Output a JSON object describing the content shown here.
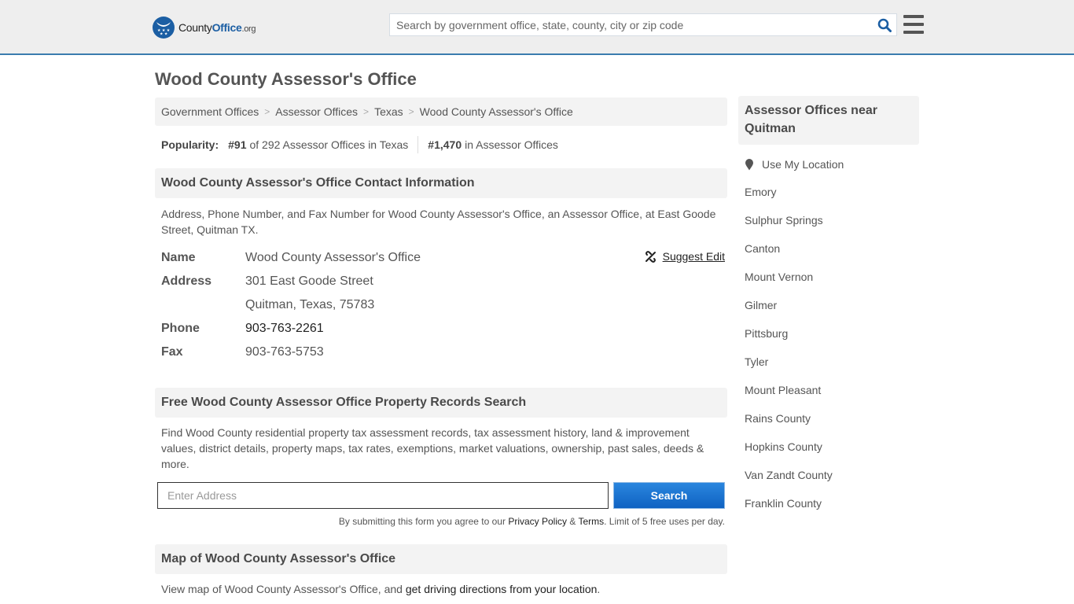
{
  "header": {
    "logo": {
      "brand_main": "County",
      "brand_accent": "Office",
      "brand_tld": ".org"
    },
    "search": {
      "placeholder": "Search by government office, state, county, city or zip code",
      "value": ""
    },
    "icons": {
      "search": "search-icon",
      "menu": "hamburger-menu-icon"
    }
  },
  "page": {
    "title": "Wood County Assessor's Office"
  },
  "breadcrumb": [
    {
      "label": "Government Offices"
    },
    {
      "label": "Assessor Offices"
    },
    {
      "label": "Texas"
    },
    {
      "label": "Wood County Assessor's Office"
    }
  ],
  "breadcrumb_separator": ">",
  "popularity": {
    "label": "Popularity:",
    "state_rank": "#91",
    "state_rank_text": "of 292 Assessor Offices in Texas",
    "national_rank": "#1,470",
    "national_rank_text": "in Assessor Offices"
  },
  "contact": {
    "heading": "Wood County Assessor's Office Contact Information",
    "description": "Address, Phone Number, and Fax Number for Wood County Assessor's Office, an Assessor Office, at East Goode Street, Quitman TX.",
    "suggest_edit": "Suggest Edit",
    "name_label": "Name",
    "name_value": "Wood County Assessor's Office",
    "address_label": "Address",
    "address_line1": "301 East Goode Street",
    "address_line2": "Quitman, Texas, 75783",
    "phone_label": "Phone",
    "phone_value": "903-763-2261",
    "fax_label": "Fax",
    "fax_value": "903-763-5753"
  },
  "property_search": {
    "heading": "Free Wood County Assessor Office Property Records Search",
    "description": "Find Wood County residential property tax assessment records, tax assessment history, land & improvement values, district details, property maps, tax rates, exemptions, market valuations, ownership, past sales, deeds & more.",
    "input_placeholder": "Enter Address",
    "input_value": "",
    "button_label": "Search",
    "disclaimer_prefix": "By submitting this form you agree to our ",
    "privacy_link": "Privacy Policy",
    "amp": " & ",
    "terms_link": "Terms",
    "disclaimer_suffix": ". Limit of 5 free uses per day."
  },
  "map": {
    "heading": "Map of Wood County Assessor's Office",
    "description_prefix": "View map of Wood County Assessor's Office, and ",
    "directions_link": "get driving directions from your location",
    "description_suffix": "."
  },
  "sidebar": {
    "heading": "Assessor Offices near Quitman",
    "use_location": "Use My Location",
    "nearby": [
      {
        "label": "Emory"
      },
      {
        "label": "Sulphur Springs"
      },
      {
        "label": "Canton"
      },
      {
        "label": "Mount Vernon"
      },
      {
        "label": "Gilmer"
      },
      {
        "label": "Pittsburg"
      },
      {
        "label": "Tyler"
      },
      {
        "label": "Mount Pleasant"
      },
      {
        "label": "Rains County"
      },
      {
        "label": "Hopkins County"
      },
      {
        "label": "Van Zandt County"
      },
      {
        "label": "Franklin County"
      }
    ]
  },
  "colors": {
    "brand_blue": "#1b5ea3",
    "header_border": "#3a7cae",
    "button_blue": "#1a72d0",
    "panel_gray": "#f3f3f3"
  }
}
